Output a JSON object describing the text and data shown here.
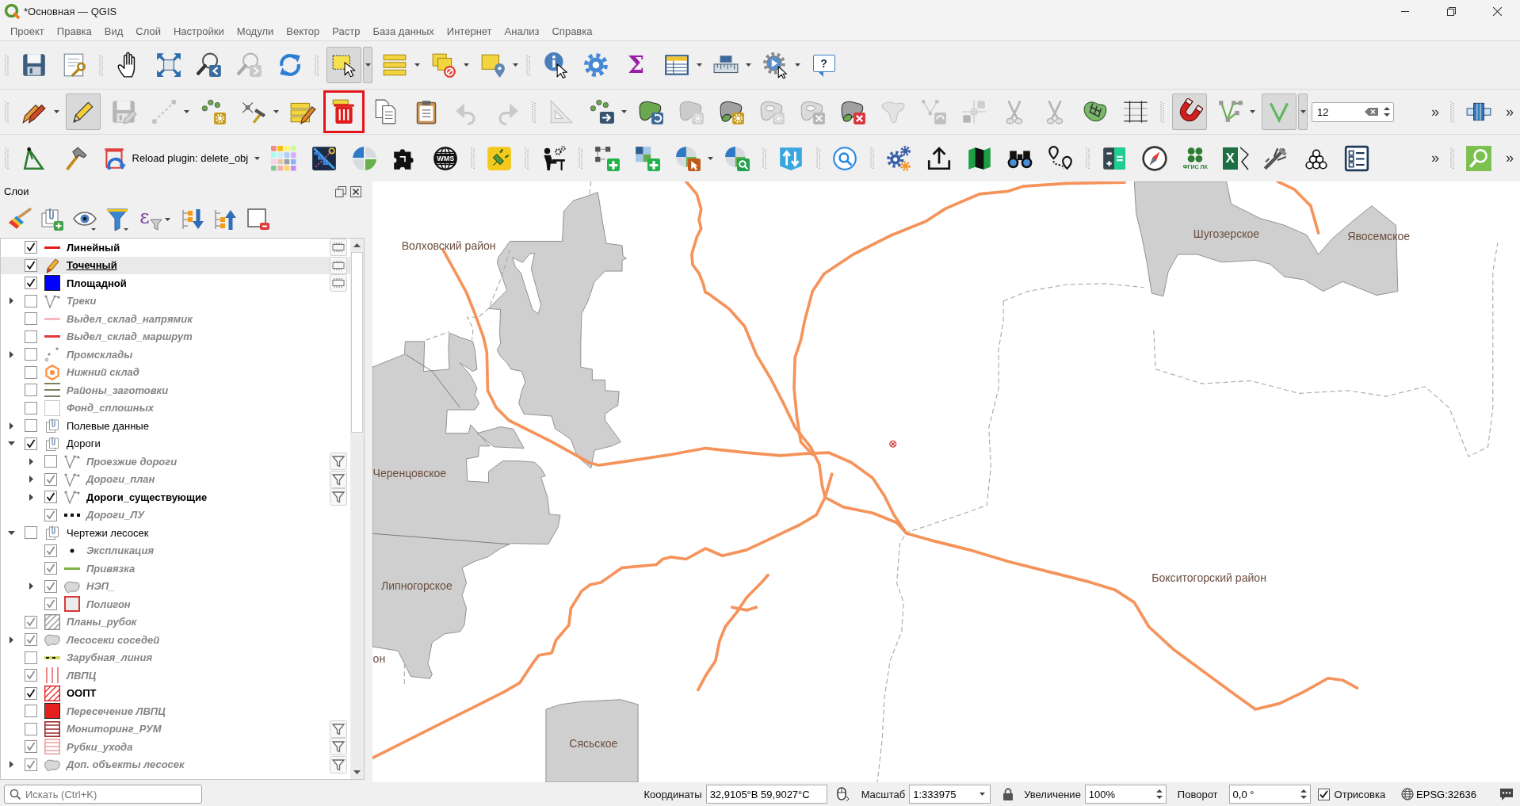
{
  "window": {
    "title": "*Основная — QGIS"
  },
  "menu": [
    {
      "label": "Проект"
    },
    {
      "label": "Правка"
    },
    {
      "label": "Вид"
    },
    {
      "label": "Слой"
    },
    {
      "label": "Настройки"
    },
    {
      "label": "Модули"
    },
    {
      "label": "Вектор"
    },
    {
      "label": "Растр"
    },
    {
      "label": "База данных"
    },
    {
      "label": "Интернет"
    },
    {
      "label": "Анализ"
    },
    {
      "label": "Справка"
    }
  ],
  "toolbar_rows": [
    {
      "toolbars": [
        {
          "tools": [
            {
              "kind": "button",
              "pressed": false,
              "disabled": false,
              "menu": false,
              "highlighted": false
            },
            {
              "kind": "button",
              "pressed": false,
              "disabled": false,
              "menu": false,
              "highlighted": false
            }
          ]
        },
        {
          "tools": [
            {
              "kind": "button",
              "pressed": false,
              "disabled": false,
              "menu": false,
              "highlighted": false
            },
            {
              "kind": "button",
              "pressed": false,
              "disabled": false,
              "menu": false,
              "highlighted": false
            },
            {
              "kind": "button",
              "pressed": false,
              "disabled": false,
              "menu": false,
              "highlighted": false
            },
            {
              "kind": "button",
              "pressed": false,
              "disabled": true,
              "menu": false,
              "highlighted": false
            },
            {
              "kind": "button",
              "pressed": false,
              "disabled": false,
              "menu": false,
              "highlighted": false
            }
          ]
        },
        {
          "tools": [
            {
              "kind": "button",
              "pressed": true,
              "disabled": false,
              "menu": true,
              "highlighted": false
            },
            {
              "kind": "button",
              "pressed": false,
              "disabled": false,
              "menu": true,
              "highlighted": false
            },
            {
              "kind": "button",
              "pressed": false,
              "disabled": false,
              "menu": true,
              "highlighted": false
            },
            {
              "kind": "button",
              "pressed": false,
              "disabled": false,
              "menu": true,
              "highlighted": false
            }
          ]
        },
        {
          "tools": [
            {
              "kind": "button",
              "pressed": false,
              "disabled": false,
              "menu": false,
              "highlighted": false
            },
            {
              "kind": "button",
              "pressed": false,
              "disabled": false,
              "menu": false,
              "highlighted": false
            },
            {
              "kind": "button",
              "pressed": false,
              "disabled": false,
              "menu": false,
              "highlighted": false,
              "label": "Σ"
            },
            {
              "kind": "button",
              "pressed": false,
              "disabled": false,
              "menu": true,
              "highlighted": false
            },
            {
              "kind": "button",
              "pressed": false,
              "disabled": false,
              "menu": true,
              "highlighted": false
            },
            {
              "kind": "button",
              "pressed": false,
              "disabled": false,
              "menu": true,
              "highlighted": false
            },
            {
              "kind": "button",
              "pressed": false,
              "disabled": false,
              "menu": false,
              "highlighted": false,
              "label": "?"
            }
          ]
        }
      ]
    },
    {
      "toolbars": [
        {
          "tools": [
            {
              "kind": "button",
              "pressed": false,
              "disabled": false,
              "menu": true,
              "highlighted": false
            },
            {
              "kind": "button",
              "pressed": true,
              "disabled": false,
              "menu": false,
              "highlighted": false
            },
            {
              "kind": "button",
              "pressed": false,
              "disabled": true,
              "menu": false,
              "highlighted": false
            },
            {
              "kind": "button",
              "pressed": false,
              "disabled": true,
              "menu": true,
              "highlighted": false
            },
            {
              "kind": "button",
              "pressed": false,
              "disabled": false,
              "menu": false,
              "highlighted": false
            },
            {
              "kind": "button",
              "pressed": false,
              "disabled": false,
              "menu": true,
              "highlighted": false
            },
            {
              "kind": "button",
              "pressed": false,
              "disabled": false,
              "menu": false,
              "highlighted": false
            },
            {
              "kind": "button",
              "pressed": false,
              "disabled": false,
              "menu": false,
              "highlighted": true
            },
            {
              "kind": "button",
              "pressed": false,
              "disabled": false,
              "menu": false,
              "highlighted": false
            },
            {
              "kind": "button",
              "pressed": false,
              "disabled": false,
              "menu": false,
              "highlighted": false
            },
            {
              "kind": "button",
              "pressed": false,
              "disabled": true,
              "menu": false,
              "highlighted": false
            },
            {
              "kind": "button",
              "pressed": false,
              "disabled": true,
              "menu": false,
              "highlighted": false
            }
          ]
        },
        {
          "tools": [
            {
              "kind": "button",
              "pressed": false,
              "disabled": true,
              "menu": false,
              "highlighted": false
            },
            {
              "kind": "button",
              "pressed": false,
              "disabled": false,
              "menu": true,
              "highlighted": false
            },
            {
              "kind": "button",
              "pressed": false,
              "disabled": false,
              "menu": false,
              "highlighted": false
            },
            {
              "kind": "button",
              "pressed": false,
              "disabled": true,
              "menu": false,
              "highlighted": false
            },
            {
              "kind": "button",
              "pressed": false,
              "disabled": false,
              "menu": false,
              "highlighted": false
            },
            {
              "kind": "button",
              "pressed": false,
              "disabled": true,
              "menu": false,
              "highlighted": false
            },
            {
              "kind": "button",
              "pressed": false,
              "disabled": true,
              "menu": false,
              "highlighted": false
            },
            {
              "kind": "button",
              "pressed": false,
              "disabled": false,
              "menu": false,
              "highlighted": false
            },
            {
              "kind": "button",
              "pressed": false,
              "disabled": true,
              "menu": false,
              "highlighted": false
            },
            {
              "kind": "button",
              "pressed": false,
              "disabled": true,
              "menu": false,
              "highlighted": false
            },
            {
              "kind": "button",
              "pressed": false,
              "disabled": true,
              "menu": false,
              "highlighted": false
            },
            {
              "kind": "button",
              "pressed": false,
              "disabled": true,
              "menu": false,
              "highlighted": false
            },
            {
              "kind": "button",
              "pressed": false,
              "disabled": true,
              "menu": false,
              "highlighted": false
            },
            {
              "kind": "button",
              "pressed": false,
              "disabled": false,
              "menu": false,
              "highlighted": false
            },
            {
              "kind": "button",
              "pressed": false,
              "disabled": false,
              "menu": false,
              "highlighted": false
            }
          ]
        },
        {
          "tools": [
            {
              "kind": "button",
              "pressed": true,
              "disabled": false,
              "menu": false,
              "highlighted": false
            },
            {
              "kind": "button",
              "pressed": false,
              "disabled": false,
              "menu": true,
              "highlighted": false
            },
            {
              "kind": "button",
              "pressed": true,
              "disabled": false,
              "menu": true,
              "highlighted": false
            },
            {
              "kind": "spinbox",
              "value": "12"
            },
            {
              "kind": "overflow",
              "label": "»"
            }
          ]
        },
        {
          "tools": [
            {
              "kind": "button",
              "pressed": false,
              "disabled": false,
              "menu": false,
              "highlighted": false
            },
            {
              "kind": "overflow",
              "label": "»"
            }
          ]
        }
      ]
    },
    {
      "toolbars": [
        {
          "tools": [
            {
              "kind": "button",
              "pressed": false,
              "disabled": false,
              "menu": false,
              "highlighted": false
            },
            {
              "kind": "button",
              "pressed": false,
              "disabled": false,
              "menu": false,
              "highlighted": false
            },
            {
              "kind": "button",
              "pressed": false,
              "disabled": false,
              "menu": true,
              "highlighted": false,
              "label": "Reload plugin: delete_obj"
            },
            {
              "kind": "button",
              "pressed": false,
              "disabled": false,
              "menu": false,
              "highlighted": false
            },
            {
              "kind": "button",
              "pressed": false,
              "disabled": false,
              "menu": false,
              "highlighted": false
            },
            {
              "kind": "button",
              "pressed": false,
              "disabled": false,
              "menu": false,
              "highlighted": false
            },
            {
              "kind": "button",
              "pressed": false,
              "disabled": false,
              "menu": false,
              "highlighted": false
            },
            {
              "kind": "button",
              "pressed": false,
              "disabled": false,
              "menu": false,
              "highlighted": false,
              "label": "WMS"
            }
          ]
        },
        {
          "tools": [
            {
              "kind": "button",
              "pressed": false,
              "disabled": false,
              "menu": false,
              "highlighted": false
            }
          ]
        },
        {
          "tools": [
            {
              "kind": "button",
              "pressed": false,
              "disabled": false,
              "menu": false,
              "highlighted": false
            }
          ]
        },
        {
          "tools": [
            {
              "kind": "button",
              "pressed": false,
              "disabled": false,
              "menu": false,
              "highlighted": false
            },
            {
              "kind": "button",
              "pressed": false,
              "disabled": false,
              "menu": false,
              "highlighted": false
            },
            {
              "kind": "button",
              "pressed": false,
              "disabled": false,
              "menu": true,
              "highlighted": false
            },
            {
              "kind": "button",
              "pressed": false,
              "disabled": false,
              "menu": false,
              "highlighted": false
            }
          ]
        },
        {
          "tools": [
            {
              "kind": "button",
              "pressed": false,
              "disabled": false,
              "menu": false,
              "highlighted": false
            }
          ]
        },
        {
          "tools": [
            {
              "kind": "button",
              "pressed": false,
              "disabled": false,
              "menu": false,
              "highlighted": false
            }
          ]
        },
        {
          "tools": [
            {
              "kind": "button",
              "pressed": false,
              "disabled": false,
              "menu": false,
              "highlighted": false
            },
            {
              "kind": "button",
              "pressed": false,
              "disabled": false,
              "menu": false,
              "highlighted": false
            },
            {
              "kind": "button",
              "pressed": false,
              "disabled": false,
              "menu": false,
              "highlighted": false
            },
            {
              "kind": "button",
              "pressed": false,
              "disabled": false,
              "menu": false,
              "highlighted": false
            },
            {
              "kind": "button",
              "pressed": false,
              "disabled": false,
              "menu": false,
              "highlighted": false
            }
          ]
        },
        {
          "tools": [
            {
              "kind": "button",
              "pressed": false,
              "disabled": false,
              "menu": false,
              "highlighted": false
            },
            {
              "kind": "button",
              "pressed": false,
              "disabled": false,
              "menu": false,
              "highlighted": false
            },
            {
              "kind": "button",
              "pressed": false,
              "disabled": false,
              "menu": false,
              "highlighted": false,
              "label": "ФГИС ЛК"
            },
            {
              "kind": "button",
              "pressed": false,
              "disabled": false,
              "menu": false,
              "highlighted": false,
              "label": "X"
            },
            {
              "kind": "button",
              "pressed": false,
              "disabled": false,
              "menu": false,
              "highlighted": false
            },
            {
              "kind": "button",
              "pressed": false,
              "disabled": false,
              "menu": false,
              "highlighted": false
            },
            {
              "kind": "button",
              "pressed": false,
              "disabled": false,
              "menu": false,
              "highlighted": false
            },
            {
              "kind": "overflow",
              "label": "»"
            }
          ]
        },
        {
          "tools": [
            {
              "kind": "button",
              "pressed": false,
              "disabled": false,
              "menu": false,
              "highlighted": false
            },
            {
              "kind": "overflow",
              "label": "»"
            }
          ]
        }
      ]
    }
  ],
  "layers_panel": {
    "title": "Слои",
    "expression_button": {
      "label": "ε"
    },
    "layers": [
      {
        "name": "Линейный",
        "checked": true,
        "selected": false,
        "dimmed": false,
        "kind": "line",
        "color": "#e31a1c",
        "temporary": true,
        "filtered": false
      },
      {
        "name": "Точечный",
        "checked": true,
        "selected": true,
        "dimmed": false,
        "kind": "editing",
        "temporary": true,
        "filtered": false
      },
      {
        "name": "Площадной",
        "checked": true,
        "selected": false,
        "dimmed": false,
        "kind": "fill",
        "color": "#0000ff",
        "temporary": true,
        "filtered": false
      },
      {
        "name": "Треки",
        "checked": false,
        "selected": false,
        "dimmed": true,
        "kind": "vertex",
        "expanded": false,
        "temporary": false,
        "filtered": false
      },
      {
        "name": "Выдел_склад_напрямик",
        "checked": false,
        "selected": false,
        "dimmed": true,
        "kind": "line",
        "color": "#f6b8b8",
        "temporary": false,
        "filtered": false
      },
      {
        "name": "Выдел_склад_маршрут",
        "checked": false,
        "selected": false,
        "dimmed": true,
        "kind": "line",
        "color": "#e0393e",
        "temporary": false,
        "filtered": false
      },
      {
        "name": "Промсклады",
        "checked": false,
        "selected": false,
        "dimmed": true,
        "kind": "points",
        "expanded": false,
        "temporary": false,
        "filtered": false
      },
      {
        "name": "Нижний склад",
        "checked": false,
        "selected": false,
        "dimmed": true,
        "kind": "hexagon",
        "color": "#ff8c3a",
        "temporary": false,
        "filtered": false
      },
      {
        "name": "Районы_заготовки",
        "checked": false,
        "selected": false,
        "dimmed": true,
        "kind": "stripes",
        "color": "#7e7e62",
        "temporary": false,
        "filtered": false
      },
      {
        "name": "Фонд_сплошных",
        "checked": false,
        "selected": false,
        "dimmed": true,
        "kind": "outline",
        "temporary": false,
        "filtered": false
      },
      {
        "name": "Полевые данные",
        "checked": false,
        "selected": false,
        "dimmed": false,
        "kind": "group",
        "expanded": false,
        "temporary": false,
        "filtered": false
      },
      {
        "name": "Дороги",
        "checked": true,
        "selected": false,
        "dimmed": false,
        "kind": "group",
        "expanded": true,
        "temporary": false,
        "filtered": false,
        "children": [
          {
            "name": "Проезжие дороги",
            "checked": false,
            "selected": false,
            "dimmed": true,
            "kind": "vertex",
            "expanded": false,
            "temporary": false,
            "filtered": true
          },
          {
            "name": "Дороги_план",
            "checked": true,
            "selected": false,
            "dimmed": true,
            "kind": "vertex",
            "expanded": false,
            "temporary": false,
            "filtered": true
          },
          {
            "name": "Дороги_существующие",
            "checked": true,
            "selected": false,
            "dimmed": false,
            "kind": "vertex",
            "expanded": false,
            "temporary": false,
            "filtered": true
          },
          {
            "name": "Дороги_ЛУ",
            "checked": true,
            "selected": false,
            "dimmed": true,
            "kind": "dashed",
            "color": "#111111",
            "temporary": false,
            "filtered": false
          }
        ]
      },
      {
        "name": "Чертежи лесосек",
        "checked": false,
        "selected": false,
        "dimmed": false,
        "kind": "group",
        "expanded": true,
        "temporary": false,
        "filtered": false,
        "children": [
          {
            "name": "Экспликация",
            "checked": true,
            "selected": false,
            "dimmed": true,
            "kind": "dot",
            "temporary": false,
            "filtered": false
          },
          {
            "name": "Привязка",
            "checked": true,
            "selected": false,
            "dimmed": true,
            "kind": "line",
            "color": "#7cb342",
            "temporary": false,
            "filtered": false
          },
          {
            "name": "НЭП_",
            "checked": true,
            "selected": false,
            "dimmed": true,
            "kind": "blob",
            "expanded": false,
            "temporary": false,
            "filtered": false
          },
          {
            "name": "Полигон",
            "checked": true,
            "selected": false,
            "dimmed": true,
            "kind": "framed",
            "color": "#d9383a",
            "temporary": false,
            "filtered": false
          }
        ]
      },
      {
        "name": "Планы_рубок",
        "checked": true,
        "selected": false,
        "dimmed": true,
        "kind": "hatch",
        "color": "#8c8c8c",
        "temporary": false,
        "filtered": false
      },
      {
        "name": "Лесосеки соседей",
        "checked": true,
        "selected": false,
        "dimmed": true,
        "kind": "blob",
        "expanded": false,
        "temporary": false,
        "filtered": false
      },
      {
        "name": "Зарубная_линия",
        "checked": false,
        "selected": false,
        "dimmed": true,
        "kind": "cased_dashed",
        "color": "#d8d860",
        "temporary": false,
        "filtered": false
      },
      {
        "name": "ЛВПЦ",
        "checked": true,
        "selected": false,
        "dimmed": true,
        "kind": "vlines",
        "color": "#ef8a8a",
        "temporary": false,
        "filtered": false
      },
      {
        "name": "ООПТ",
        "checked": true,
        "selected": false,
        "dimmed": false,
        "kind": "hatch",
        "color": "#e31a1c",
        "temporary": false,
        "filtered": false
      },
      {
        "name": "Пересечение ЛВПЦ",
        "checked": false,
        "selected": false,
        "dimmed": true,
        "kind": "fill",
        "color": "#e5201f",
        "temporary": false,
        "filtered": false
      },
      {
        "name": "Мониторинг_РУМ",
        "checked": false,
        "selected": false,
        "dimmed": true,
        "kind": "hlines",
        "color": "#9e2a2b",
        "temporary": false,
        "filtered": true
      },
      {
        "name": "Рубки_ухода",
        "checked": true,
        "selected": false,
        "dimmed": true,
        "kind": "hlines",
        "color": "#e8a3a3",
        "temporary": false,
        "filtered": true
      },
      {
        "name": "Доп. объекты лесосек",
        "checked": true,
        "selected": false,
        "dimmed": true,
        "kind": "blob",
        "expanded": false,
        "temporary": false,
        "filtered": true
      }
    ]
  },
  "map": {
    "labels": [
      {
        "text": "Волховский район"
      },
      {
        "text": "Шугозерское"
      },
      {
        "text": "Явосемское"
      },
      {
        "text": "Черенцовское"
      },
      {
        "text": "Липногорское"
      },
      {
        "text": "Бокситогорский район"
      },
      {
        "text": "он"
      },
      {
        "text": "Сясьское"
      }
    ]
  },
  "status_bar": {
    "locator": {
      "placeholder": "Искать (Ctrl+K)"
    },
    "coordinate": {
      "label": "Координаты",
      "value": "32,9105°В 59,9027°С"
    },
    "scale": {
      "label": "Масштаб",
      "value": "1:333975"
    },
    "magnifier": {
      "label": "Увеличение",
      "value": "100%"
    },
    "rotation": {
      "label": "Поворот",
      "value": "0,0 °"
    },
    "render": {
      "label": "Отрисовка",
      "checked": true
    },
    "crs": {
      "label": "EPSG:32636"
    }
  }
}
